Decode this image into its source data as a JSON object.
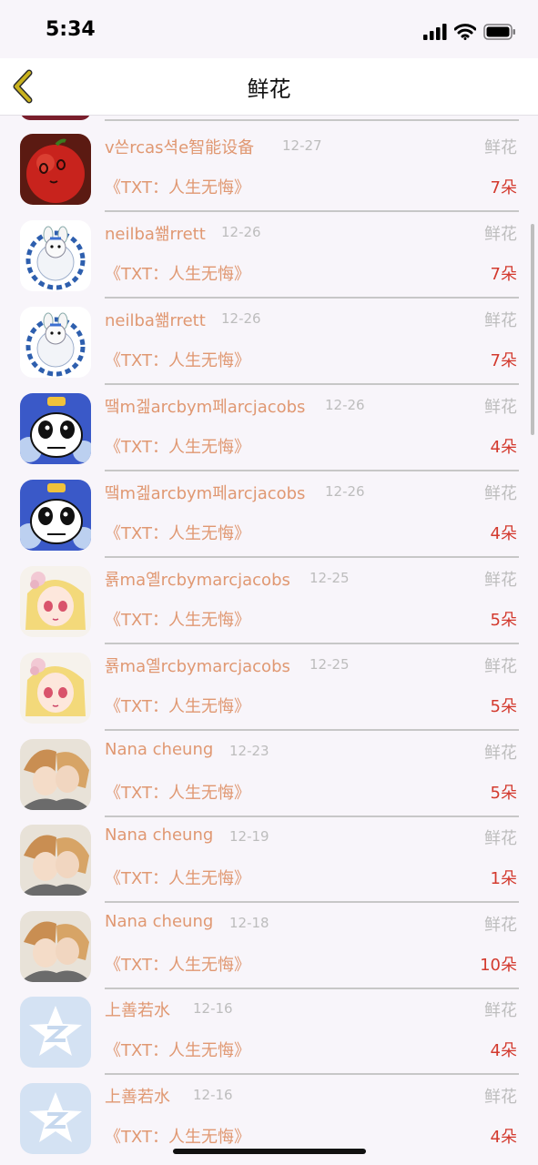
{
  "status_bar": {
    "time": "5:34"
  },
  "nav": {
    "title": "鲜花"
  },
  "list": {
    "rows": [
      {
        "name": "v쓴rcas셕e智能设备",
        "date": "12-27",
        "type": "鲜花",
        "book": "《TXT：人生无悔》",
        "count": "7朵",
        "avatar": "red-apple"
      },
      {
        "name": "neilba쐚rrett",
        "date": "12-26",
        "type": "鲜花",
        "book": "《TXT：人生无悔》",
        "count": "7朵",
        "avatar": "blue-bunny-plate"
      },
      {
        "name": "neilba쐚rrett",
        "date": "12-26",
        "type": "鲜花",
        "book": "《TXT：人生无悔》",
        "count": "7朵",
        "avatar": "blue-bunny-plate"
      },
      {
        "name": "땤m겚arcbym페arcjacobs",
        "date": "12-26",
        "type": "鲜花",
        "book": "《TXT：人生无悔》",
        "count": "4朵",
        "avatar": "panda-cartoon"
      },
      {
        "name": "땤m겚arcbym페arcjacobs",
        "date": "12-26",
        "type": "鲜花",
        "book": "《TXT：人生无悔》",
        "count": "4朵",
        "avatar": "panda-cartoon"
      },
      {
        "name": "룕ma옐rcbymarcjacobs",
        "date": "12-25",
        "type": "鲜花",
        "book": "《TXT：人生无悔》",
        "count": "5朵",
        "avatar": "blonde-girl"
      },
      {
        "name": "룕ma옐rcbymarcjacobs",
        "date": "12-25",
        "type": "鲜花",
        "book": "《TXT：人生无悔》",
        "count": "5朵",
        "avatar": "blonde-girl"
      },
      {
        "name": "Nana cheung",
        "date": "12-23",
        "type": "鲜花",
        "book": "《TXT：人生无悔》",
        "count": "5朵",
        "avatar": "anime-couple"
      },
      {
        "name": "Nana cheung",
        "date": "12-19",
        "type": "鲜花",
        "book": "《TXT：人生无悔》",
        "count": "1朵",
        "avatar": "anime-couple"
      },
      {
        "name": "Nana cheung",
        "date": "12-18",
        "type": "鲜花",
        "book": "《TXT：人生无悔》",
        "count": "10朵",
        "avatar": "anime-couple"
      },
      {
        "name": "上善若水",
        "date": "12-16",
        "type": "鲜花",
        "book": "《TXT：人生无悔》",
        "count": "4朵",
        "avatar": "default-star"
      },
      {
        "name": "上善若水",
        "date": "12-16",
        "type": "鲜花",
        "book": "《TXT：人生无悔》",
        "count": "4朵",
        "avatar": "default-star"
      }
    ]
  },
  "colors": {
    "name": "#e09872",
    "count": "#d33a2e",
    "muted": "#bdbdbd",
    "back_arrow": "#c9b21e"
  }
}
